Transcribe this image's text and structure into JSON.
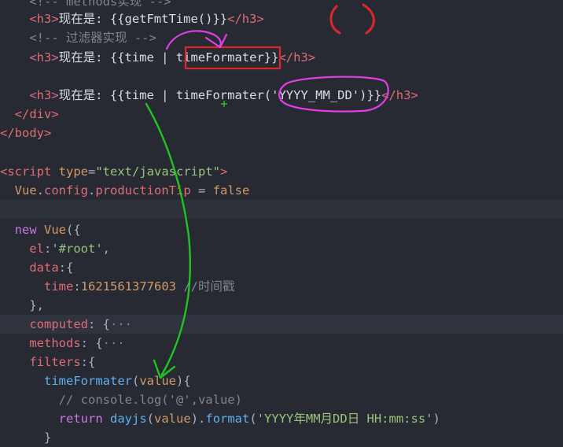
{
  "code": {
    "l1_comment": "<!-- methods实现 -->",
    "l2_open": "<h3>",
    "l2_text": "现在是: {{getFmtTime()}}",
    "l2_close": "</h3>",
    "l3_comment": "<!-- 过滤器实现 -->",
    "l4_open": "<h3>",
    "l4_text_a": "现在是: {{time | ",
    "l4_filter": "timeFormater",
    "l4_text_b": "}}",
    "l4_close": "</h3>",
    "l6_open": "<h3>",
    "l6_text_a": "现在是: {{time | ",
    "l6_filter": "timeFormater",
    "l6_arg": "('YYYY_MM_DD')",
    "l6_text_b": "}}",
    "l6_close": "</h3>",
    "l7": "</div>",
    "l8": "</body>",
    "l10_open": "<script",
    "l10_attr": "type",
    "l10_eq": "=",
    "l10_val": "\"text/javascript\"",
    "l10_end": ">",
    "l11_vue": "Vue",
    "l11_dot1": ".",
    "l11_config": "config",
    "l11_dot2": ".",
    "l11_prod": "productionTip",
    "l11_eq": " = ",
    "l11_false": "false",
    "l13_new": "new",
    "l13_vue": "Vue",
    "l13_paren": "({",
    "l14_el": "el",
    "l14_colon": ":",
    "l14_val": "'#root'",
    "l14_comma": ",",
    "l15_data": "data",
    "l15_rest": ":{",
    "l16_time": "time",
    "l16_colon": ":",
    "l16_num": "1621561377603",
    "l16_comment": " //时间戳",
    "l17": "},",
    "l18_computed": "computed",
    "l18_rest": ": {",
    "l18_fold": "···",
    "l19_methods": "methods",
    "l19_rest": ": {",
    "l19_fold": "···",
    "l20_filters": "filters",
    "l20_rest": ":{",
    "l21_name": "timeFormater",
    "l21_paren": "(",
    "l21_arg": "value",
    "l21_rest": "){",
    "l22_comment": "// console.log('@',value)",
    "l23_return": "return",
    "l23_dayjs": "dayjs",
    "l23_p1": "(",
    "l23_value": "value",
    "l23_p2": ").",
    "l23_format": "format",
    "l23_p3": "(",
    "l23_str": "'YYYY年MM月DD日 HH:mm:ss'",
    "l23_p4": ")",
    "l24": "}"
  },
  "colors": {
    "background": "#272a33",
    "annotation_red": "#e0252b",
    "annotation_magenta": "#e23ee6",
    "annotation_green": "#22c222"
  }
}
